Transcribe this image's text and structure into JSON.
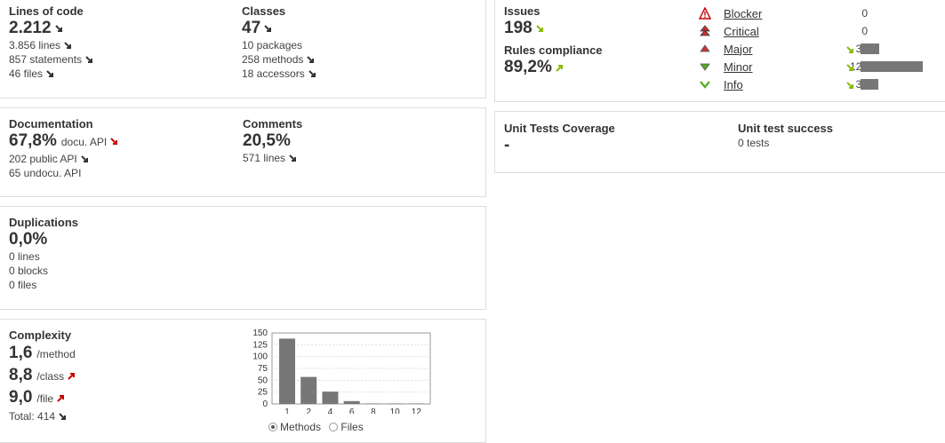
{
  "lines_of_code": {
    "title": "Lines of code",
    "value": "2.212",
    "lines": "3.856 lines",
    "statements": "857 statements",
    "files": "46 files"
  },
  "classes": {
    "title": "Classes",
    "value": "47",
    "packages": "10 packages",
    "methods": "258 methods",
    "accessors": "18 accessors"
  },
  "documentation": {
    "title": "Documentation",
    "value": "67,8%",
    "value_unit": "docu. API",
    "public_api": "202 public API",
    "undocu_api": "65 undocu. API"
  },
  "comments": {
    "title": "Comments",
    "value": "20,5%",
    "lines": "571 lines"
  },
  "duplications": {
    "title": "Duplications",
    "value": "0,0%",
    "lines": "0 lines",
    "blocks": "0 blocks",
    "files": "0 files"
  },
  "complexity": {
    "title": "Complexity",
    "per_method": "1,6",
    "per_method_unit": "/method",
    "per_class": "8,8",
    "per_class_unit": "/class",
    "per_file": "9,0",
    "per_file_unit": "/file",
    "total": "Total: 414",
    "radio_methods": "Methods",
    "radio_files": "Files",
    "selected": "Methods"
  },
  "chart_data": {
    "type": "bar",
    "categories": [
      "1",
      "2",
      "4",
      "6",
      "8",
      "10",
      "12"
    ],
    "values": [
      138,
      57,
      26,
      6,
      1,
      1,
      1
    ],
    "ylim": [
      0,
      150
    ],
    "yticks": [
      "0",
      "25",
      "50",
      "75",
      "100",
      "125",
      "150"
    ],
    "ytick_values": [
      0,
      25,
      50,
      75,
      100,
      125,
      150
    ],
    "grid": true,
    "bar_color": "#777777"
  },
  "issues": {
    "title": "Issues",
    "value": "198"
  },
  "rules_compliance": {
    "title": "Rules compliance",
    "value": "89,2%"
  },
  "severities": [
    {
      "label": "Blocker",
      "count": "0",
      "icon": "blocker-icon",
      "bar": 0
    },
    {
      "label": "Critical",
      "count": "0",
      "icon": "critical-icon",
      "bar": 0
    },
    {
      "label": "Major",
      "count": "39",
      "icon": "major-icon",
      "bar": 0.3
    },
    {
      "label": "Minor",
      "count": "123",
      "icon": "minor-icon",
      "bar": 1.0
    },
    {
      "label": "Info",
      "count": "36",
      "icon": "info-icon",
      "bar": 0.28
    }
  ],
  "unit_tests_coverage": {
    "title": "Unit Tests Coverage",
    "value": "-"
  },
  "unit_test_success": {
    "title": "Unit test success",
    "tests": "0 tests"
  },
  "colors": {
    "arrow_dark": "#333333",
    "arrow_red": "#cc0000",
    "arrow_green": "#88bb00",
    "bar": "#777777"
  }
}
